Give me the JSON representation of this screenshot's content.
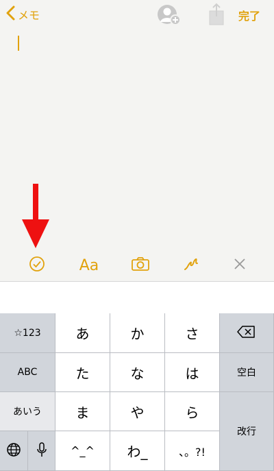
{
  "nav": {
    "back_label": "メモ",
    "done_label": "完了"
  },
  "colors": {
    "accent": "#e1a20d",
    "arrow": "#ee1111"
  },
  "toolbar": {
    "format_label": "Aa",
    "icons": [
      "checklist-icon",
      "format-text",
      "camera-icon",
      "sketch-icon",
      "close-icon"
    ]
  },
  "keyboard": {
    "left_keys": {
      "numbers": "☆123",
      "abc": "ABC",
      "hiragana": "あいう"
    },
    "rows": [
      [
        "あ",
        "か",
        "さ"
      ],
      [
        "た",
        "な",
        "は"
      ],
      [
        "ま",
        "や",
        "ら"
      ],
      [
        "^_^",
        "わ_",
        "、。?!"
      ]
    ],
    "space_label": "空白",
    "return_label": "改行"
  }
}
